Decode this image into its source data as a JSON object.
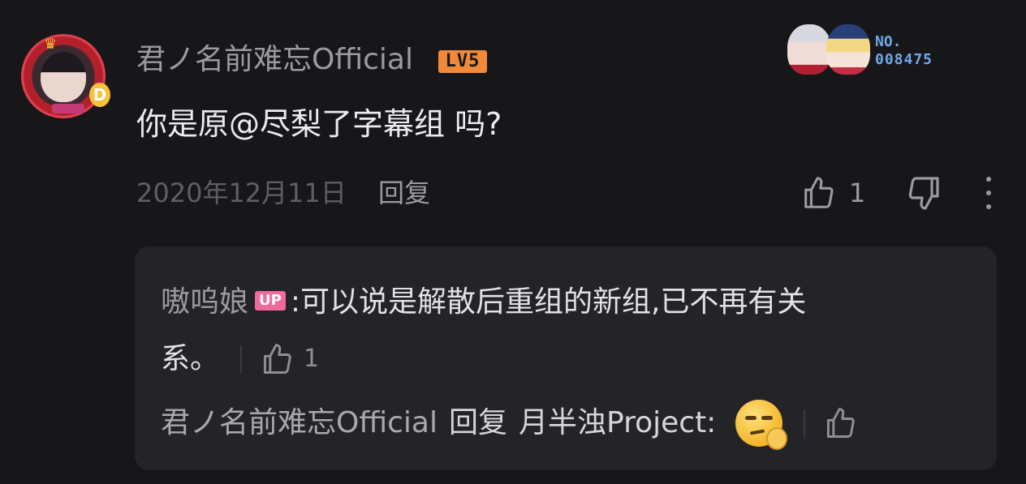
{
  "comment": {
    "username": "君ノ名前难忘Official",
    "level": "LV5",
    "decoration": {
      "label": "NO.",
      "number": "008475"
    },
    "message": "你是原@尽梨了字幕组 吗?",
    "date": "2020年12月11日",
    "reply_label": "回复",
    "like_count": "1"
  },
  "replies": {
    "first": {
      "user": "嗷呜娘",
      "badge": "UP",
      "text_line1": ":可以说是解散后重组的新组,已不再有关",
      "text_line2": "系。",
      "like_count": "1"
    },
    "second": {
      "user": "君ノ名前难忘Official",
      "reply_word": "回复",
      "target": "月半浊Project:"
    }
  },
  "colors": {
    "background": "#17171a",
    "reply_box": "#242428",
    "level_badge": "#f08a3a",
    "up_badge": "#f06b9c",
    "decoration_text": "#6ea8e8"
  },
  "icons": [
    "thumbs-up-icon",
    "thumbs-down-icon",
    "more-vertical-icon",
    "smug-emoji-icon"
  ]
}
